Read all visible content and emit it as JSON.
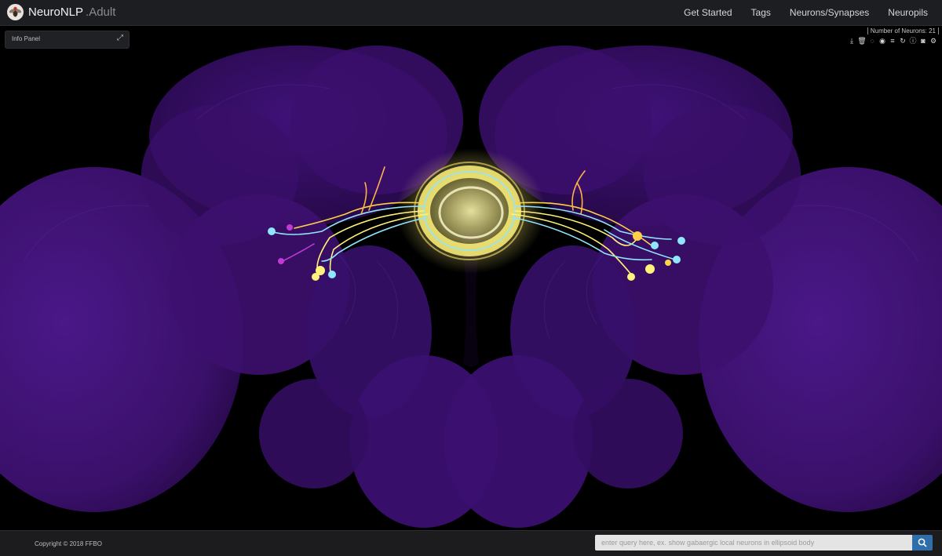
{
  "app": {
    "name": "NeuroNLP",
    "subtitle": ".Adult",
    "logo_icon": "fly-logo-icon"
  },
  "nav": {
    "items": [
      {
        "label": "Get Started"
      },
      {
        "label": "Tags"
      },
      {
        "label": "Neurons/Synapses"
      },
      {
        "label": "Neuropils"
      }
    ]
  },
  "info_panel": {
    "label": "Info Panel",
    "expand_icon": "expand-icon"
  },
  "viewer": {
    "neuron_count_label": "Number of Neurons: 21",
    "neuron_count": 21,
    "brain_color": "#3d1170",
    "neuron_colors": [
      "#fff27a",
      "#8fe6ff",
      "#ffd04a",
      "#c23ad6"
    ],
    "tools": [
      {
        "icon": "download-icon",
        "glyph": "⤓"
      },
      {
        "icon": "trash-icon",
        "glyph": "🗑"
      },
      {
        "icon": "hide-icon",
        "glyph": "◌"
      },
      {
        "icon": "eye-icon",
        "glyph": "◉"
      },
      {
        "icon": "list-icon",
        "glyph": "≡"
      },
      {
        "icon": "refresh-icon",
        "glyph": "↻"
      },
      {
        "icon": "info-icon",
        "glyph": "ⓘ"
      },
      {
        "icon": "camera-icon",
        "glyph": "◙"
      },
      {
        "icon": "settings-icon",
        "glyph": "⚙"
      }
    ]
  },
  "footer": {
    "copyright": "Copyright © 2018 FFBO",
    "search_placeholder": "enter query here, ex. show gabaergic local neurons in ellipsoid body",
    "search_icon": "search-icon",
    "accent": "#2f6ea8"
  }
}
